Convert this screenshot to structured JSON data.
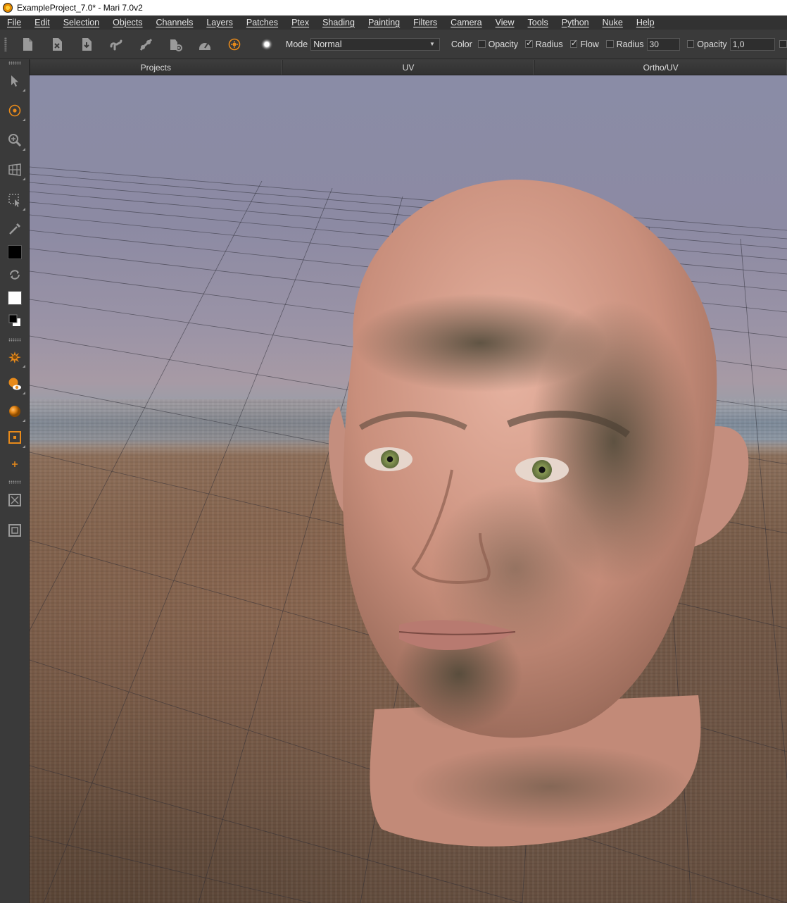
{
  "window": {
    "title": "ExampleProject_7.0* - Mari 7.0v2"
  },
  "menu": [
    "File",
    "Edit",
    "Selection",
    "Objects",
    "Channels",
    "Layers",
    "Patches",
    "Ptex",
    "Shading",
    "Painting",
    "Filters",
    "Camera",
    "View",
    "Tools",
    "Python",
    "Nuke",
    "Help"
  ],
  "toolbar": {
    "mode_label": "Mode",
    "mode_value": "Normal",
    "color_label": "Color",
    "opacity_label": "Opacity",
    "radius_label": "Radius",
    "flow_label": "Flow",
    "radius2_label": "Radius",
    "radius2_value": "30",
    "opacity2_label": "Opacity",
    "opacity2_value": "1,0",
    "checks": {
      "color": false,
      "opacity": true,
      "radius": true,
      "flow": false,
      "opacity2": false,
      "trailing": false
    }
  },
  "tabs": [
    "Projects",
    "UV",
    "Ortho/UV"
  ],
  "colors": {
    "accent": "#e88a1a",
    "fg_swatch": "#000000",
    "bg_swatch": "#ffffff"
  },
  "icons": {
    "toolbar": [
      "new-project-icon",
      "close-project-icon",
      "import-icon",
      "link-icon",
      "merge-icon",
      "settings-icon",
      "gauge-icon",
      "paint-target-icon",
      "brush-preview-icon"
    ],
    "left": [
      "select-arrow-icon",
      "paint-target-icon",
      "zoom-icon",
      "grid-icon",
      "marquee-select-icon",
      "eyedropper-icon",
      "foreground-color-icon",
      "swap-colors-icon",
      "background-color-icon",
      "default-colors-icon",
      "splatter-icon",
      "paint-through-icon",
      "shaded-sphere-icon",
      "patch-select-icon",
      "small-plus-icon",
      "close-box-icon",
      "frame-icon"
    ]
  }
}
